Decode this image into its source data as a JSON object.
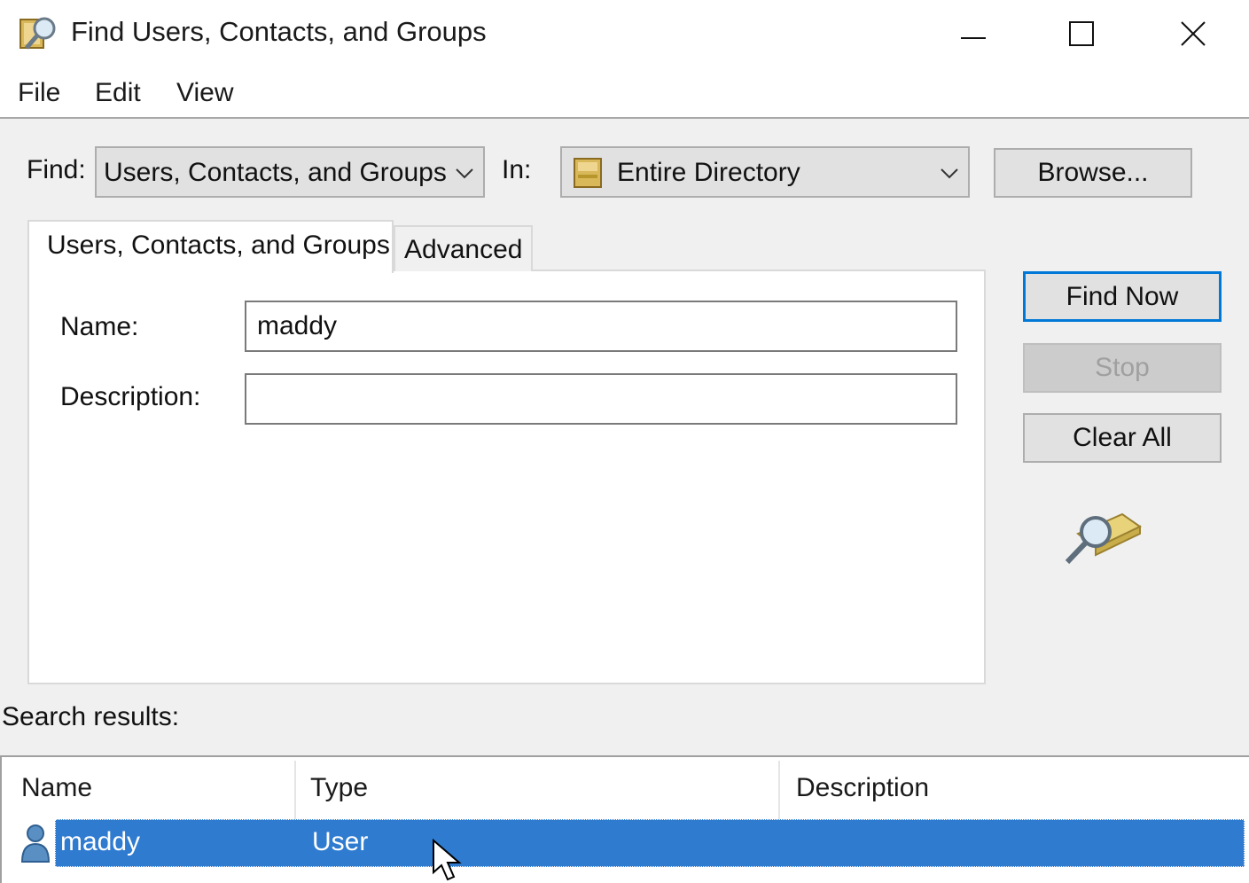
{
  "window": {
    "title": "Find Users, Contacts, and Groups"
  },
  "menu": [
    "File",
    "Edit",
    "View"
  ],
  "find": {
    "find_label": "Find:",
    "find_value": "Users, Contacts, and Groups",
    "in_label": "In:",
    "in_value": "Entire Directory",
    "browse_label": "Browse..."
  },
  "tabs": {
    "active": "Users, Contacts, and Groups",
    "inactive": "Advanced"
  },
  "form": {
    "name_label": "Name:",
    "name_value": "maddy",
    "description_label": "Description:",
    "description_value": ""
  },
  "actions": {
    "find_now": "Find Now",
    "stop": "Stop",
    "clear_all": "Clear All"
  },
  "results": {
    "label": "Search results:",
    "columns": [
      "Name",
      "Type",
      "Description"
    ],
    "rows": [
      {
        "name": "maddy",
        "type": "User",
        "description": ""
      }
    ]
  },
  "colors": {
    "selection": "#2e7bd0",
    "default_button_border": "#0078d7"
  }
}
